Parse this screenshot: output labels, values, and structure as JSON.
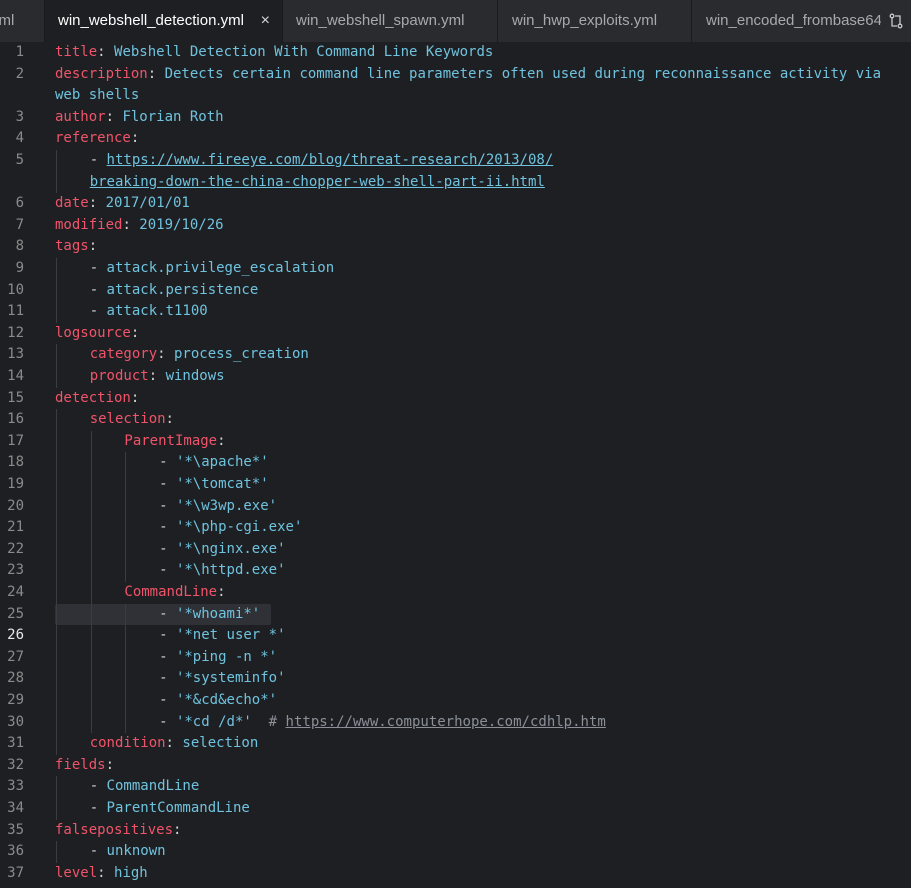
{
  "tabs": [
    {
      "label": "yml",
      "active": false
    },
    {
      "label": "win_webshell_detection.yml",
      "active": true,
      "close": "×"
    },
    {
      "label": "win_webshell_spawn.yml",
      "active": false
    },
    {
      "label": "win_hwp_exploits.yml",
      "active": false
    },
    {
      "label": "win_encoded_frombase64",
      "active": false
    }
  ],
  "tab_actions_icon": "compare-icon",
  "current_line": 26,
  "lines": [
    {
      "n": "1",
      "indent": 0,
      "tokens": [
        {
          "t": "title",
          "c": "k"
        },
        {
          "t": ": ",
          "c": "p"
        },
        {
          "t": "Webshell Detection With Command Line Keywords",
          "c": "v"
        }
      ]
    },
    {
      "n": "2",
      "indent": 0,
      "tokens": [
        {
          "t": "description",
          "c": "k"
        },
        {
          "t": ": ",
          "c": "p"
        },
        {
          "t": "Detects certain command line parameters often used during reconnaissance activity via",
          "c": "v"
        }
      ]
    },
    {
      "n": "",
      "indent": 0,
      "tokens": [
        {
          "t": "web shells",
          "c": "v"
        }
      ]
    },
    {
      "n": "3",
      "indent": 0,
      "tokens": [
        {
          "t": "author",
          "c": "k"
        },
        {
          "t": ": ",
          "c": "p"
        },
        {
          "t": "Florian Roth",
          "c": "v"
        }
      ]
    },
    {
      "n": "4",
      "indent": 0,
      "tokens": [
        {
          "t": "reference",
          "c": "k"
        },
        {
          "t": ":",
          "c": "p"
        }
      ]
    },
    {
      "n": "5",
      "indent": 1,
      "tokens": [
        {
          "t": "- ",
          "c": "p"
        },
        {
          "t": "https://www.fireeye.com/blog/threat-research/2013/08/",
          "c": "u"
        }
      ]
    },
    {
      "n": "",
      "indent": 1,
      "tokens": [
        {
          "t": "breaking-down-the-china-chopper-web-shell-part-ii.html",
          "c": "u"
        }
      ]
    },
    {
      "n": "6",
      "indent": 0,
      "tokens": [
        {
          "t": "date",
          "c": "k"
        },
        {
          "t": ": ",
          "c": "p"
        },
        {
          "t": "2017/01/01",
          "c": "v"
        }
      ]
    },
    {
      "n": "7",
      "indent": 0,
      "tokens": [
        {
          "t": "modified",
          "c": "k"
        },
        {
          "t": ": ",
          "c": "p"
        },
        {
          "t": "2019/10/26",
          "c": "v"
        }
      ]
    },
    {
      "n": "8",
      "indent": 0,
      "tokens": [
        {
          "t": "tags",
          "c": "k"
        },
        {
          "t": ":",
          "c": "p"
        }
      ]
    },
    {
      "n": "9",
      "indent": 1,
      "tokens": [
        {
          "t": "- ",
          "c": "p"
        },
        {
          "t": "attack.privilege_escalation",
          "c": "v"
        }
      ]
    },
    {
      "n": "10",
      "indent": 1,
      "tokens": [
        {
          "t": "- ",
          "c": "p"
        },
        {
          "t": "attack.persistence",
          "c": "v"
        }
      ]
    },
    {
      "n": "11",
      "indent": 1,
      "tokens": [
        {
          "t": "- ",
          "c": "p"
        },
        {
          "t": "attack.t1100",
          "c": "v"
        }
      ]
    },
    {
      "n": "12",
      "indent": 0,
      "tokens": [
        {
          "t": "logsource",
          "c": "k"
        },
        {
          "t": ":",
          "c": "p"
        }
      ]
    },
    {
      "n": "13",
      "indent": 1,
      "tokens": [
        {
          "t": "category",
          "c": "k"
        },
        {
          "t": ": ",
          "c": "p"
        },
        {
          "t": "process_creation",
          "c": "v"
        }
      ]
    },
    {
      "n": "14",
      "indent": 1,
      "tokens": [
        {
          "t": "product",
          "c": "k"
        },
        {
          "t": ": ",
          "c": "p"
        },
        {
          "t": "windows",
          "c": "v"
        }
      ]
    },
    {
      "n": "15",
      "indent": 0,
      "tokens": [
        {
          "t": "detection",
          "c": "k"
        },
        {
          "t": ":",
          "c": "p"
        }
      ]
    },
    {
      "n": "16",
      "indent": 1,
      "tokens": [
        {
          "t": "selection",
          "c": "k"
        },
        {
          "t": ":",
          "c": "p"
        }
      ]
    },
    {
      "n": "17",
      "indent": 2,
      "tokens": [
        {
          "t": "ParentImage",
          "c": "k"
        },
        {
          "t": ":",
          "c": "p"
        }
      ]
    },
    {
      "n": "18",
      "indent": 3,
      "tokens": [
        {
          "t": "- ",
          "c": "p"
        },
        {
          "t": "'*\\apache*'",
          "c": "v"
        }
      ]
    },
    {
      "n": "19",
      "indent": 3,
      "tokens": [
        {
          "t": "- ",
          "c": "p"
        },
        {
          "t": "'*\\tomcat*'",
          "c": "v"
        }
      ]
    },
    {
      "n": "20",
      "indent": 3,
      "tokens": [
        {
          "t": "- ",
          "c": "p"
        },
        {
          "t": "'*\\w3wp.exe'",
          "c": "v"
        }
      ]
    },
    {
      "n": "21",
      "indent": 3,
      "tokens": [
        {
          "t": "- ",
          "c": "p"
        },
        {
          "t": "'*\\php-cgi.exe'",
          "c": "v"
        }
      ]
    },
    {
      "n": "22",
      "indent": 3,
      "tokens": [
        {
          "t": "- ",
          "c": "p"
        },
        {
          "t": "'*\\nginx.exe'",
          "c": "v"
        }
      ]
    },
    {
      "n": "23",
      "indent": 3,
      "tokens": [
        {
          "t": "- ",
          "c": "p"
        },
        {
          "t": "'*\\httpd.exe'",
          "c": "v"
        }
      ]
    },
    {
      "n": "24",
      "indent": 2,
      "tokens": [
        {
          "t": "CommandLine",
          "c": "k"
        },
        {
          "t": ":",
          "c": "p"
        }
      ]
    },
    {
      "n": "25",
      "indent": 3,
      "highlight": true,
      "tokens": [
        {
          "t": "- ",
          "c": "p"
        },
        {
          "t": "'*whoami*'",
          "c": "v"
        }
      ]
    },
    {
      "n": "26",
      "indent": 3,
      "tokens": [
        {
          "t": "- ",
          "c": "p"
        },
        {
          "t": "'*net user *'",
          "c": "v"
        }
      ]
    },
    {
      "n": "27",
      "indent": 3,
      "tokens": [
        {
          "t": "- ",
          "c": "p"
        },
        {
          "t": "'*ping -n *'",
          "c": "v"
        }
      ]
    },
    {
      "n": "28",
      "indent": 3,
      "tokens": [
        {
          "t": "- ",
          "c": "p"
        },
        {
          "t": "'*systeminfo'",
          "c": "v"
        }
      ]
    },
    {
      "n": "29",
      "indent": 3,
      "tokens": [
        {
          "t": "- ",
          "c": "p"
        },
        {
          "t": "'*&cd&echo*'",
          "c": "v"
        }
      ]
    },
    {
      "n": "30",
      "indent": 3,
      "tokens": [
        {
          "t": "- ",
          "c": "p"
        },
        {
          "t": "'*cd /d*'",
          "c": "v"
        },
        {
          "t": "  # ",
          "c": "c"
        },
        {
          "t": "https://www.computerhope.com/cdhlp.htm",
          "c": "cu"
        }
      ]
    },
    {
      "n": "31",
      "indent": 1,
      "tokens": [
        {
          "t": "condition",
          "c": "k"
        },
        {
          "t": ": ",
          "c": "p"
        },
        {
          "t": "selection",
          "c": "v"
        }
      ]
    },
    {
      "n": "32",
      "indent": 0,
      "tokens": [
        {
          "t": "fields",
          "c": "k"
        },
        {
          "t": ":",
          "c": "p"
        }
      ]
    },
    {
      "n": "33",
      "indent": 1,
      "tokens": [
        {
          "t": "- ",
          "c": "p"
        },
        {
          "t": "CommandLine",
          "c": "v"
        }
      ]
    },
    {
      "n": "34",
      "indent": 1,
      "tokens": [
        {
          "t": "- ",
          "c": "p"
        },
        {
          "t": "ParentCommandLine",
          "c": "v"
        }
      ]
    },
    {
      "n": "35",
      "indent": 0,
      "tokens": [
        {
          "t": "falsepositives",
          "c": "k"
        },
        {
          "t": ":",
          "c": "p"
        }
      ]
    },
    {
      "n": "36",
      "indent": 1,
      "tokens": [
        {
          "t": "- ",
          "c": "p"
        },
        {
          "t": "unknown",
          "c": "v"
        }
      ]
    },
    {
      "n": "37",
      "indent": 0,
      "tokens": [
        {
          "t": "level",
          "c": "k"
        },
        {
          "t": ": ",
          "c": "p"
        },
        {
          "t": "high",
          "c": "v"
        }
      ]
    }
  ]
}
